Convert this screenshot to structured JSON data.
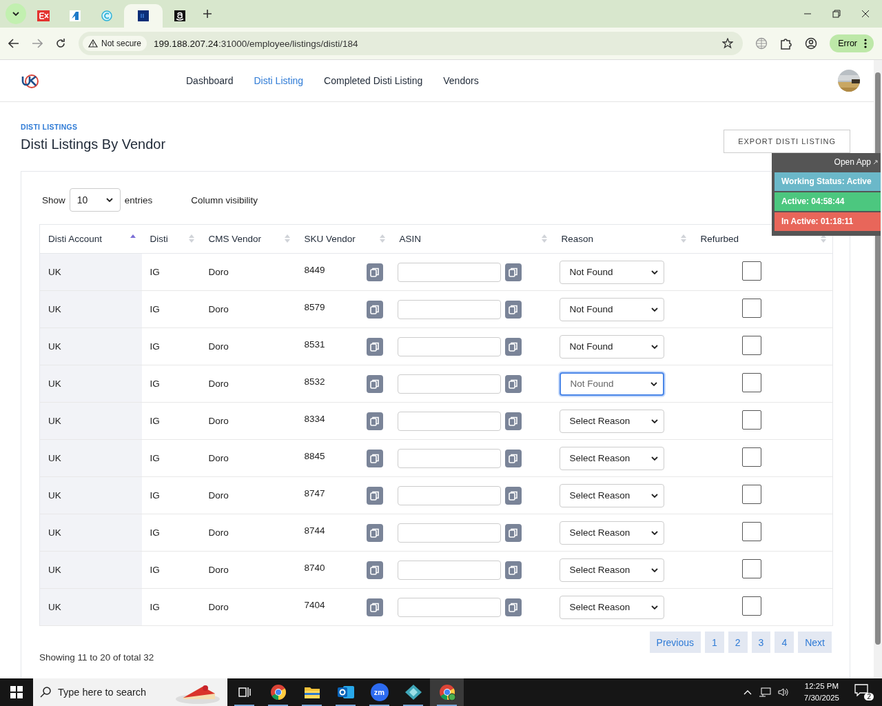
{
  "browser": {
    "tabs": [
      {
        "kind": "ex",
        "selected": false
      },
      {
        "kind": "drop",
        "selected": false
      },
      {
        "kind": "c",
        "selected": false
      },
      {
        "kind": "df",
        "selected": true
      },
      {
        "kind": "amazon",
        "selected": false
      }
    ],
    "address": {
      "security": "Not secure",
      "host": "199.188.207.24",
      "path": ":31000/employee/listings/disti/184"
    },
    "profile_button": "Error"
  },
  "nav": {
    "items": [
      {
        "label": "Dashboard",
        "selected": false
      },
      {
        "label": "Disti Listing",
        "selected": true
      },
      {
        "label": "Completed Disti Listing",
        "selected": false
      },
      {
        "label": "Vendors",
        "selected": false
      }
    ]
  },
  "page": {
    "breadcrumb": "DISTI LISTINGS",
    "title": "Disti Listings By Vendor",
    "export_button": "EXPORT DISTI LISTING"
  },
  "status_widget": {
    "open_app": "Open App",
    "working_status": "Working Status: Active",
    "active": "Active: 04:58:44",
    "inactive": "In Active: 01:18:11"
  },
  "table": {
    "show_label": "Show",
    "page_length": "10",
    "entries_label": "entries",
    "column_visibility": "Column visibility",
    "columns": [
      {
        "label": "Disti Account",
        "sorted": true
      },
      {
        "label": "Disti",
        "sorted": false
      },
      {
        "label": "CMS Vendor",
        "sorted": false
      },
      {
        "label": "SKU Vendor",
        "sorted": false
      },
      {
        "label": "ASIN",
        "sorted": false
      },
      {
        "label": "Reason",
        "sorted": false
      },
      {
        "label": "Refurbed",
        "sorted": false
      }
    ],
    "rows": [
      {
        "account": "UK",
        "disti": "IG",
        "cms_vendor": "Doro",
        "sku": "8449",
        "reason": "Not Found",
        "focused": false,
        "refurbed": false
      },
      {
        "account": "UK",
        "disti": "IG",
        "cms_vendor": "Doro",
        "sku": "8579",
        "reason": "Not Found",
        "focused": false,
        "refurbed": false
      },
      {
        "account": "UK",
        "disti": "IG",
        "cms_vendor": "Doro",
        "sku": "8531",
        "reason": "Not Found",
        "focused": false,
        "refurbed": false
      },
      {
        "account": "UK",
        "disti": "IG",
        "cms_vendor": "Doro",
        "sku": "8532",
        "reason": "Not Found",
        "focused": true,
        "refurbed": false
      },
      {
        "account": "UK",
        "disti": "IG",
        "cms_vendor": "Doro",
        "sku": "8334",
        "reason": "Select Reason",
        "focused": false,
        "refurbed": false
      },
      {
        "account": "UK",
        "disti": "IG",
        "cms_vendor": "Doro",
        "sku": "8845",
        "reason": "Select Reason",
        "focused": false,
        "refurbed": false
      },
      {
        "account": "UK",
        "disti": "IG",
        "cms_vendor": "Doro",
        "sku": "8747",
        "reason": "Select Reason",
        "focused": false,
        "refurbed": false
      },
      {
        "account": "UK",
        "disti": "IG",
        "cms_vendor": "Doro",
        "sku": "8744",
        "reason": "Select Reason",
        "focused": false,
        "refurbed": false
      },
      {
        "account": "UK",
        "disti": "IG",
        "cms_vendor": "Doro",
        "sku": "8740",
        "reason": "Select Reason",
        "focused": false,
        "refurbed": false
      },
      {
        "account": "UK",
        "disti": "IG",
        "cms_vendor": "Doro",
        "sku": "7404",
        "reason": "Select Reason",
        "focused": false,
        "refurbed": false
      }
    ],
    "info": "Showing 11 to 20 of total 32",
    "pagination": [
      "Previous",
      "1",
      "2",
      "3",
      "4",
      "Next"
    ]
  },
  "taskbar": {
    "search_placeholder": "Type here to search",
    "apps": [
      {
        "kind": "taskview",
        "selected": false
      },
      {
        "kind": "chrome",
        "selected": false
      },
      {
        "kind": "files",
        "selected": false
      },
      {
        "kind": "outlook",
        "selected": false
      },
      {
        "kind": "zoom",
        "label": "zm",
        "selected": false
      },
      {
        "kind": "gem",
        "selected": false
      },
      {
        "kind": "chrome-profile",
        "selected": true
      }
    ],
    "time": "12:25 PM",
    "date": "7/30/2025",
    "notifications": "2"
  }
}
